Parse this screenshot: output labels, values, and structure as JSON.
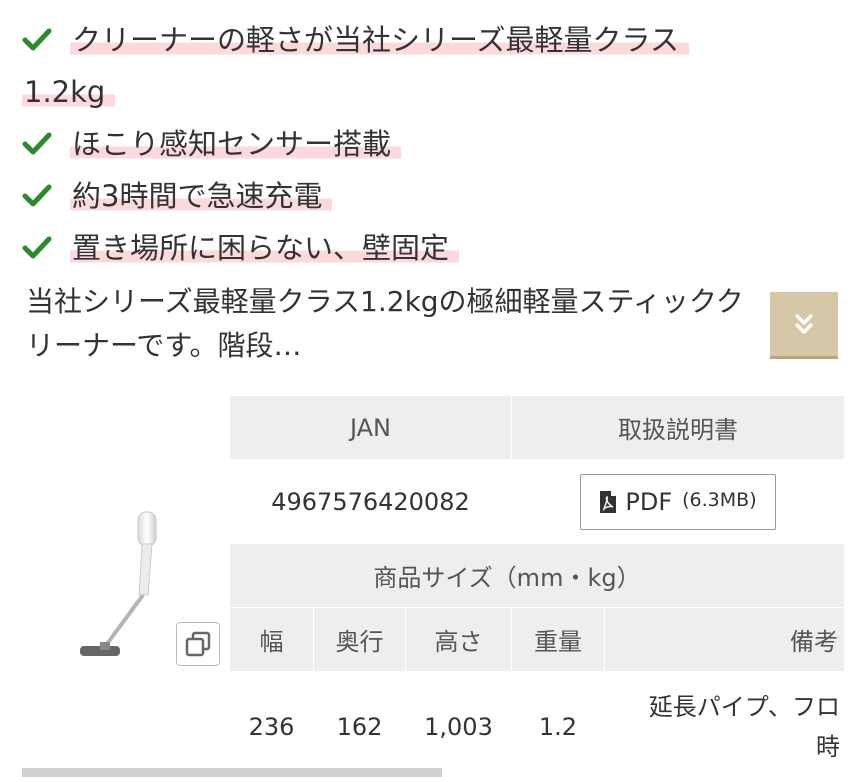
{
  "features": [
    {
      "text": "クリーナーの軽さが当社シリーズ最軽量クラス"
    },
    {
      "text": "1.2kg",
      "continuation": true
    },
    {
      "text": "ほこり感知センサー搭載"
    },
    {
      "text": "約3時間で急速充電"
    },
    {
      "text": "置き場所に困らない、壁固定"
    }
  ],
  "description": {
    "text": "当社シリーズ最軽量クラス1.2kgの極細軽量スティッククリーナーです。階段…",
    "expand_icon": "double-chevron-down-icon"
  },
  "product_image": {
    "icon": "stick-vacuum-image",
    "copy_icon": "copy-icon"
  },
  "spec_table": {
    "jan_header": "JAN",
    "manual_header": "取扱説明書",
    "jan_value": "4967576420082",
    "pdf_label": "PDF",
    "pdf_size": "(6.3MB)",
    "size_header": "商品サイズ（mm・kg）",
    "columns": [
      "幅",
      "奥行",
      "高さ",
      "重量",
      "備考"
    ],
    "values": [
      "236",
      "162",
      "1,003",
      "1.2",
      "延長パイプ、フロ\n時"
    ]
  },
  "colors": {
    "check": "#2b8a2b",
    "highlight": "#fbd9dc",
    "expand_button": "#d6c7a6",
    "table_header": "#eeeeee"
  }
}
